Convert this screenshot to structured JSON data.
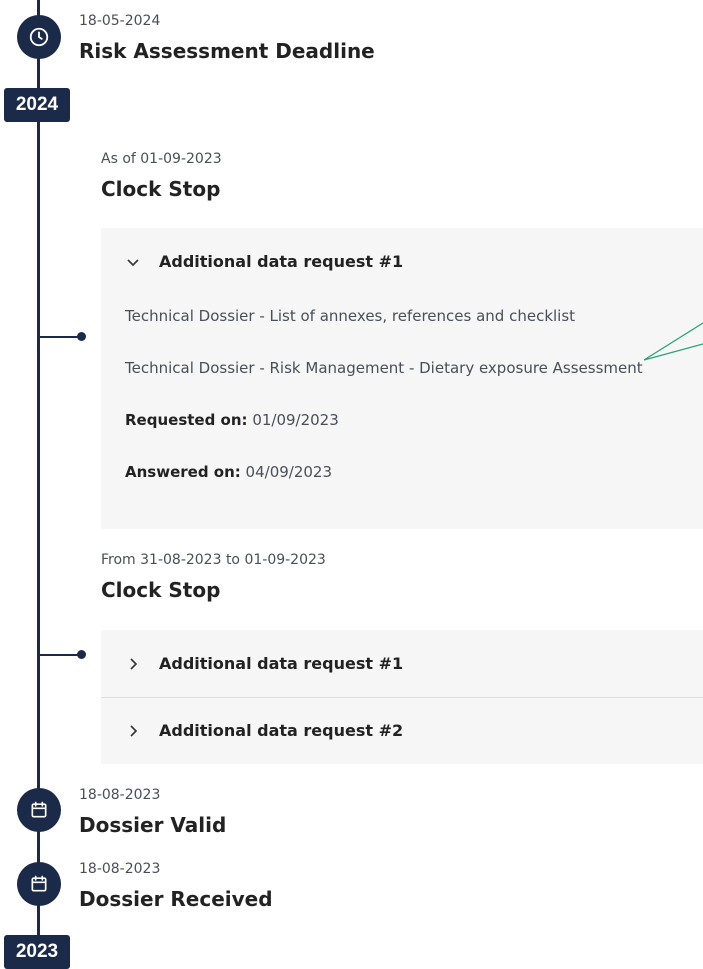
{
  "timeline": {
    "year_top": "2024",
    "year_bottom": "2023",
    "deadline": {
      "date": "18-05-2024",
      "title": "Risk Assessment Deadline",
      "icon": "clock-icon"
    },
    "clock_stop_1": {
      "date": "As of 01-09-2023",
      "title": "Clock Stop",
      "request": {
        "label": "Additional data request #1",
        "expanded": true,
        "items": [
          "Technical Dossier - List of annexes, references and checklist",
          "Technical Dossier - Risk Management - Dietary exposure Assessment"
        ],
        "requested_label": "Requested on:",
        "requested_value": "01/09/2023",
        "answered_label": "Answered on:",
        "answered_value": "04/09/2023"
      }
    },
    "clock_stop_2": {
      "date": "From 31-08-2023 to 01-09-2023",
      "title": "Clock Stop",
      "requests": [
        {
          "label": "Additional data request #1",
          "expanded": false
        },
        {
          "label": "Additional data request #2",
          "expanded": false
        }
      ]
    },
    "dossier_valid": {
      "date": "18-08-2023",
      "title": "Dossier Valid",
      "icon": "calendar-icon"
    },
    "dossier_received": {
      "date": "18-08-2023",
      "title": "Dossier Received",
      "icon": "calendar-icon"
    }
  },
  "colors": {
    "timeline": "#1b2a49",
    "panel": "#f6f6f6",
    "annotation": "#2aa37a"
  }
}
